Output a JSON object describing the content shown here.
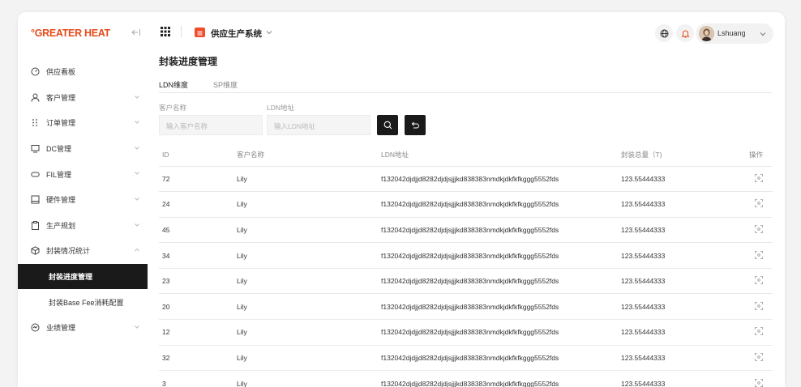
{
  "brand": {
    "logo": "GREATER HEAT",
    "logo_mark": "°",
    "collapse_icon": "collapse-icon"
  },
  "sidebar": {
    "items": [
      {
        "label": "供应看板",
        "icon": "gauge-icon",
        "chevron": false
      },
      {
        "label": "客户管理",
        "icon": "user-icon",
        "chevron": true
      },
      {
        "label": "订单管理",
        "icon": "dots-grid-icon",
        "chevron": true
      },
      {
        "label": "DC管理",
        "icon": "monitor-icon",
        "chevron": true
      },
      {
        "label": "FIL管理",
        "icon": "disk-icon",
        "chevron": true
      },
      {
        "label": "硬件管理",
        "icon": "hardware-icon",
        "chevron": true
      },
      {
        "label": "生产规划",
        "icon": "clipboard-icon",
        "chevron": true
      },
      {
        "label": "封装情况统计",
        "icon": "cube-icon",
        "chevron": "up"
      }
    ],
    "sub_items": [
      {
        "label": "封装进度管理",
        "active": true
      },
      {
        "label": "封装Base Fee消耗配置",
        "active": false
      }
    ],
    "after_items": [
      {
        "label": "业绩管理",
        "icon": "performance-icon",
        "chevron": true
      }
    ]
  },
  "header": {
    "app_name": "供应生产系统",
    "user_name": "Lshuang",
    "icons": [
      "apps-grid-icon",
      "globe-icon",
      "bell-icon",
      "chevron-down-icon"
    ]
  },
  "page": {
    "title": "封装进度管理",
    "tabs": [
      "LDN维度",
      "SP维度"
    ],
    "active_tab": 0
  },
  "filters": {
    "customer_label": "客户名称",
    "customer_placeholder": "输入客户名称",
    "ldn_label": "LDN地址",
    "ldn_placeholder": "输入LDN地址"
  },
  "table": {
    "columns": [
      "ID",
      "客户名称",
      "LDN地址",
      "封装总量（T)",
      "操作"
    ],
    "rows": [
      {
        "id": "72",
        "name": "Lily",
        "ldn": "f132042djdjjd8282djdjsjjjkd838383nmdkjdkfkfkggg5552fds",
        "total": "123.55444333"
      },
      {
        "id": "24",
        "name": "Lily",
        "ldn": "f132042djdjjd8282djdjsjjjkd838383nmdkjdkfkfkggg5552fds",
        "total": "123.55444333"
      },
      {
        "id": "45",
        "name": "Lily",
        "ldn": "f132042djdjjd8282djdjsjjjkd838383nmdkjdkfkfkggg5552fds",
        "total": "123.55444333"
      },
      {
        "id": "34",
        "name": "Lily",
        "ldn": "f132042djdjjd8282djdjsjjjkd838383nmdkjdkfkfkggg5552fds",
        "total": "123.55444333"
      },
      {
        "id": "23",
        "name": "Lily",
        "ldn": "f132042djdjjd8282djdjsjjjkd838383nmdkjdkfkfkggg5552fds",
        "total": "123.55444333"
      },
      {
        "id": "20",
        "name": "Lily",
        "ldn": "f132042djdjjd8282djdjsjjjkd838383nmdkjdkfkfkggg5552fds",
        "total": "123.55444333"
      },
      {
        "id": "12",
        "name": "Lily",
        "ldn": "f132042djdjjd8282djdjsjjjkd838383nmdkjdkfkfkggg5552fds",
        "total": "123.55444333"
      },
      {
        "id": "32",
        "name": "Lily",
        "ldn": "f132042djdjjd8282djdjsjjjkd838383nmdkjdkfkfkggg5552fds",
        "total": "123.55444333"
      },
      {
        "id": "3",
        "name": "Lily",
        "ldn": "f132042djdjjd8282djdjsjjjkd838383nmdkjdkfkfkggg5552fds",
        "total": "123.55444333"
      }
    ]
  },
  "colors": {
    "brand": "#e64a19",
    "app_icon": "#f04d2b",
    "active_nav": "#1a1a1a"
  }
}
